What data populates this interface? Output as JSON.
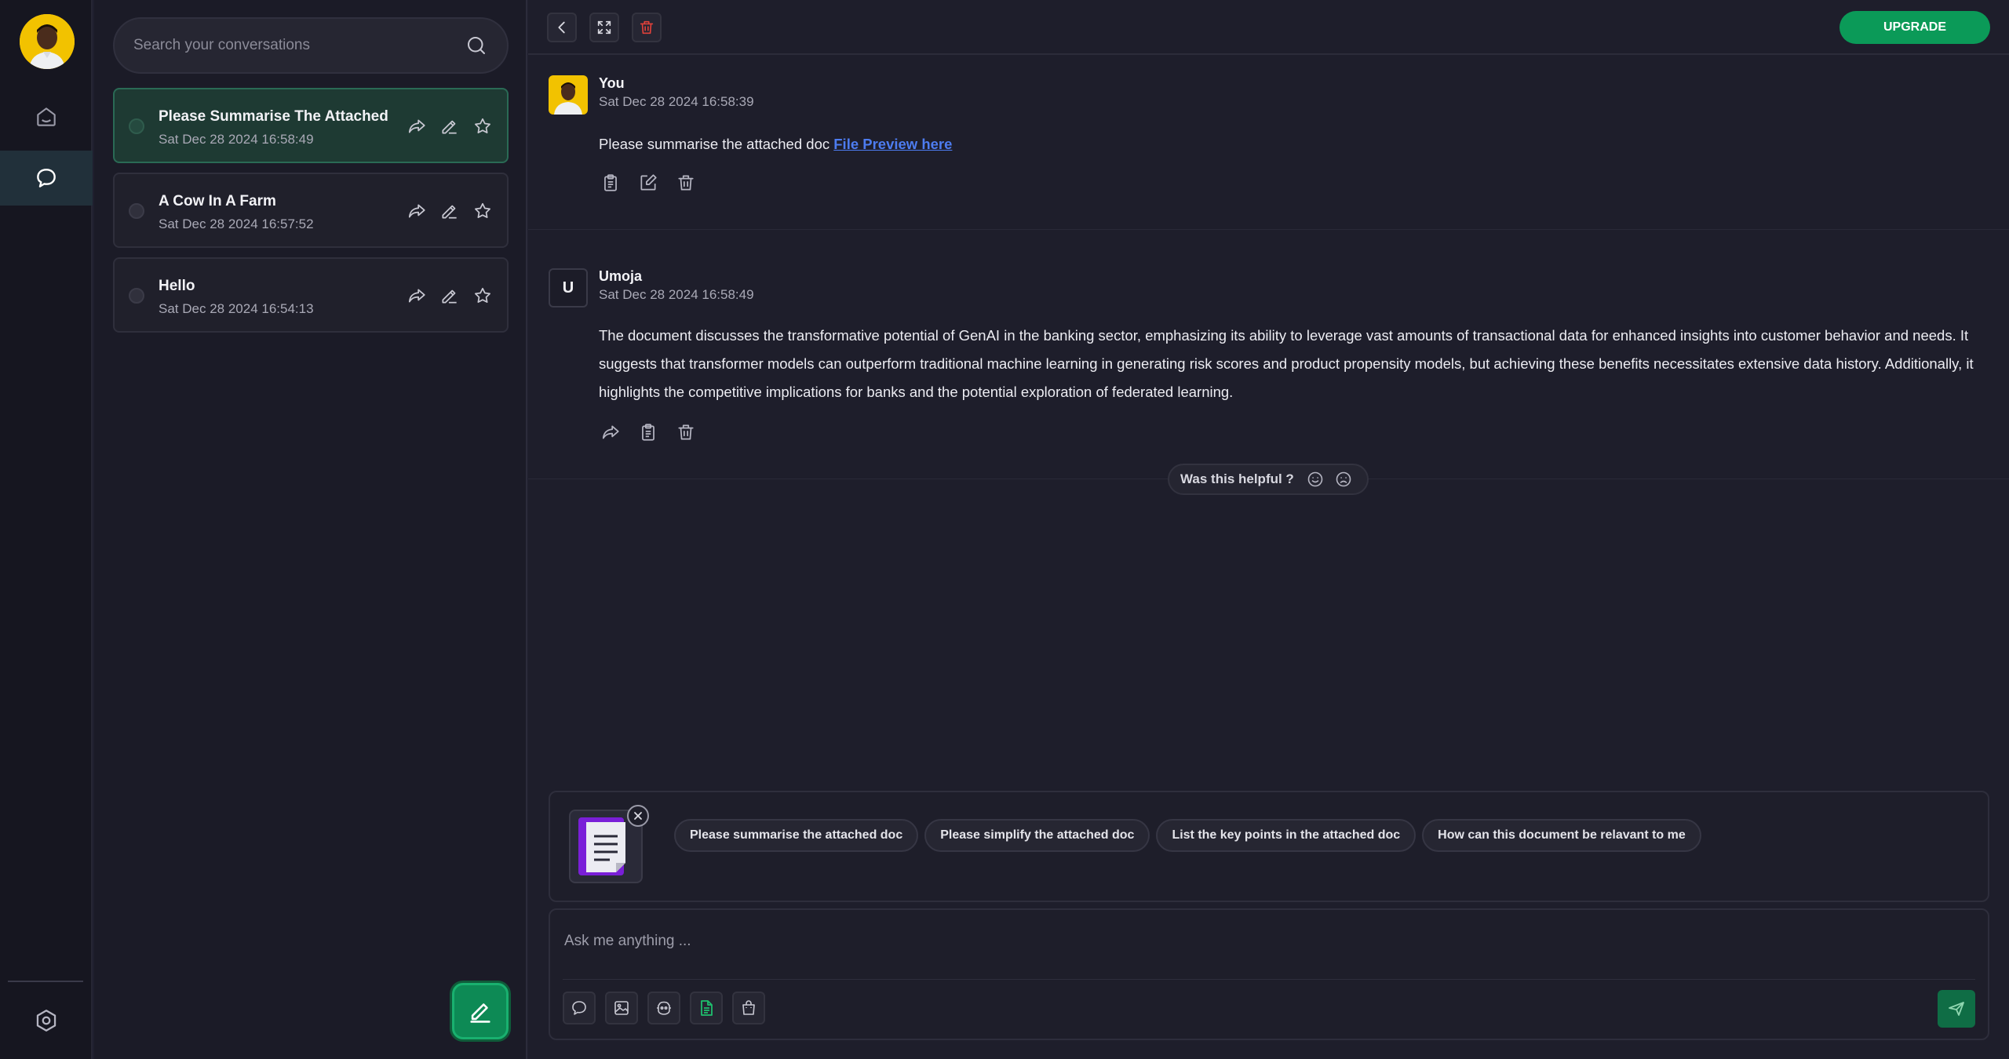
{
  "sidebar": {
    "nav": [
      {
        "name": "home",
        "icon": "home-icon"
      },
      {
        "name": "chats",
        "icon": "chat-bubble-icon",
        "active": true
      }
    ],
    "settings_icon": "settings-hex-icon"
  },
  "conversations": {
    "search_placeholder": "Search your conversations",
    "items": [
      {
        "title": "Please Summarise The Attached",
        "date": "Sat Dec 28 2024 16:58:49",
        "active": true
      },
      {
        "title": "A Cow In A Farm",
        "date": "Sat Dec 28 2024 16:57:52",
        "active": false
      },
      {
        "title": "Hello",
        "date": "Sat Dec 28 2024 16:54:13",
        "active": false
      }
    ]
  },
  "topbar": {
    "upgrade_label": "UPGRADE"
  },
  "messages": [
    {
      "author": "You",
      "time": "Sat Dec 28 2024 16:58:39",
      "text": "Please summarise the attached doc ",
      "link_text": "File Preview here"
    },
    {
      "author": "Umoja",
      "avatar_letter": "U",
      "time": "Sat Dec 28 2024 16:58:49",
      "text": "The document discusses the transformative potential of GenAI in the banking sector, emphasizing its ability to leverage vast amounts of transactional data for enhanced insights into customer behavior and needs. It suggests that transformer models can outperform traditional machine learning in generating risk scores and product propensity models, but achieving these benefits necessitates extensive data history. Additionally, it highlights the competitive implications for banks and the potential exploration of federated learning."
    }
  ],
  "feedback": {
    "label": "Was this helpful ?"
  },
  "suggestions": [
    "Please summarise the attached doc",
    "Please simplify the attached doc",
    "List the key points in the attached doc",
    "How can this document be relavant to me"
  ],
  "composer": {
    "placeholder": "Ask me anything ...",
    "tools": [
      "chat-icon",
      "image-icon",
      "bot-icon",
      "document-icon",
      "bag-icon"
    ]
  },
  "colors": {
    "accent": "#0b9a58",
    "link": "#4d7cf0",
    "delete": "#e0413a"
  }
}
